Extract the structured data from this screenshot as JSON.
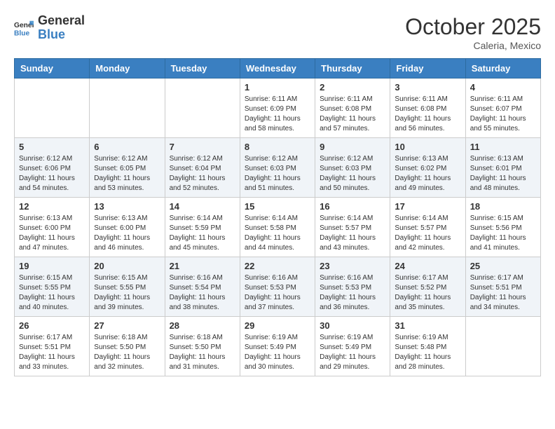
{
  "header": {
    "logo_general": "General",
    "logo_blue": "Blue",
    "month": "October 2025",
    "location": "Caleria, Mexico"
  },
  "days_of_week": [
    "Sunday",
    "Monday",
    "Tuesday",
    "Wednesday",
    "Thursday",
    "Friday",
    "Saturday"
  ],
  "weeks": [
    [
      {
        "day": "",
        "info": ""
      },
      {
        "day": "",
        "info": ""
      },
      {
        "day": "",
        "info": ""
      },
      {
        "day": "1",
        "info": "Sunrise: 6:11 AM\nSunset: 6:09 PM\nDaylight: 11 hours\nand 58 minutes."
      },
      {
        "day": "2",
        "info": "Sunrise: 6:11 AM\nSunset: 6:08 PM\nDaylight: 11 hours\nand 57 minutes."
      },
      {
        "day": "3",
        "info": "Sunrise: 6:11 AM\nSunset: 6:08 PM\nDaylight: 11 hours\nand 56 minutes."
      },
      {
        "day": "4",
        "info": "Sunrise: 6:11 AM\nSunset: 6:07 PM\nDaylight: 11 hours\nand 55 minutes."
      }
    ],
    [
      {
        "day": "5",
        "info": "Sunrise: 6:12 AM\nSunset: 6:06 PM\nDaylight: 11 hours\nand 54 minutes."
      },
      {
        "day": "6",
        "info": "Sunrise: 6:12 AM\nSunset: 6:05 PM\nDaylight: 11 hours\nand 53 minutes."
      },
      {
        "day": "7",
        "info": "Sunrise: 6:12 AM\nSunset: 6:04 PM\nDaylight: 11 hours\nand 52 minutes."
      },
      {
        "day": "8",
        "info": "Sunrise: 6:12 AM\nSunset: 6:03 PM\nDaylight: 11 hours\nand 51 minutes."
      },
      {
        "day": "9",
        "info": "Sunrise: 6:12 AM\nSunset: 6:03 PM\nDaylight: 11 hours\nand 50 minutes."
      },
      {
        "day": "10",
        "info": "Sunrise: 6:13 AM\nSunset: 6:02 PM\nDaylight: 11 hours\nand 49 minutes."
      },
      {
        "day": "11",
        "info": "Sunrise: 6:13 AM\nSunset: 6:01 PM\nDaylight: 11 hours\nand 48 minutes."
      }
    ],
    [
      {
        "day": "12",
        "info": "Sunrise: 6:13 AM\nSunset: 6:00 PM\nDaylight: 11 hours\nand 47 minutes."
      },
      {
        "day": "13",
        "info": "Sunrise: 6:13 AM\nSunset: 6:00 PM\nDaylight: 11 hours\nand 46 minutes."
      },
      {
        "day": "14",
        "info": "Sunrise: 6:14 AM\nSunset: 5:59 PM\nDaylight: 11 hours\nand 45 minutes."
      },
      {
        "day": "15",
        "info": "Sunrise: 6:14 AM\nSunset: 5:58 PM\nDaylight: 11 hours\nand 44 minutes."
      },
      {
        "day": "16",
        "info": "Sunrise: 6:14 AM\nSunset: 5:57 PM\nDaylight: 11 hours\nand 43 minutes."
      },
      {
        "day": "17",
        "info": "Sunrise: 6:14 AM\nSunset: 5:57 PM\nDaylight: 11 hours\nand 42 minutes."
      },
      {
        "day": "18",
        "info": "Sunrise: 6:15 AM\nSunset: 5:56 PM\nDaylight: 11 hours\nand 41 minutes."
      }
    ],
    [
      {
        "day": "19",
        "info": "Sunrise: 6:15 AM\nSunset: 5:55 PM\nDaylight: 11 hours\nand 40 minutes."
      },
      {
        "day": "20",
        "info": "Sunrise: 6:15 AM\nSunset: 5:55 PM\nDaylight: 11 hours\nand 39 minutes."
      },
      {
        "day": "21",
        "info": "Sunrise: 6:16 AM\nSunset: 5:54 PM\nDaylight: 11 hours\nand 38 minutes."
      },
      {
        "day": "22",
        "info": "Sunrise: 6:16 AM\nSunset: 5:53 PM\nDaylight: 11 hours\nand 37 minutes."
      },
      {
        "day": "23",
        "info": "Sunrise: 6:16 AM\nSunset: 5:53 PM\nDaylight: 11 hours\nand 36 minutes."
      },
      {
        "day": "24",
        "info": "Sunrise: 6:17 AM\nSunset: 5:52 PM\nDaylight: 11 hours\nand 35 minutes."
      },
      {
        "day": "25",
        "info": "Sunrise: 6:17 AM\nSunset: 5:51 PM\nDaylight: 11 hours\nand 34 minutes."
      }
    ],
    [
      {
        "day": "26",
        "info": "Sunrise: 6:17 AM\nSunset: 5:51 PM\nDaylight: 11 hours\nand 33 minutes."
      },
      {
        "day": "27",
        "info": "Sunrise: 6:18 AM\nSunset: 5:50 PM\nDaylight: 11 hours\nand 32 minutes."
      },
      {
        "day": "28",
        "info": "Sunrise: 6:18 AM\nSunset: 5:50 PM\nDaylight: 11 hours\nand 31 minutes."
      },
      {
        "day": "29",
        "info": "Sunrise: 6:19 AM\nSunset: 5:49 PM\nDaylight: 11 hours\nand 30 minutes."
      },
      {
        "day": "30",
        "info": "Sunrise: 6:19 AM\nSunset: 5:49 PM\nDaylight: 11 hours\nand 29 minutes."
      },
      {
        "day": "31",
        "info": "Sunrise: 6:19 AM\nSunset: 5:48 PM\nDaylight: 11 hours\nand 28 minutes."
      },
      {
        "day": "",
        "info": ""
      }
    ]
  ]
}
